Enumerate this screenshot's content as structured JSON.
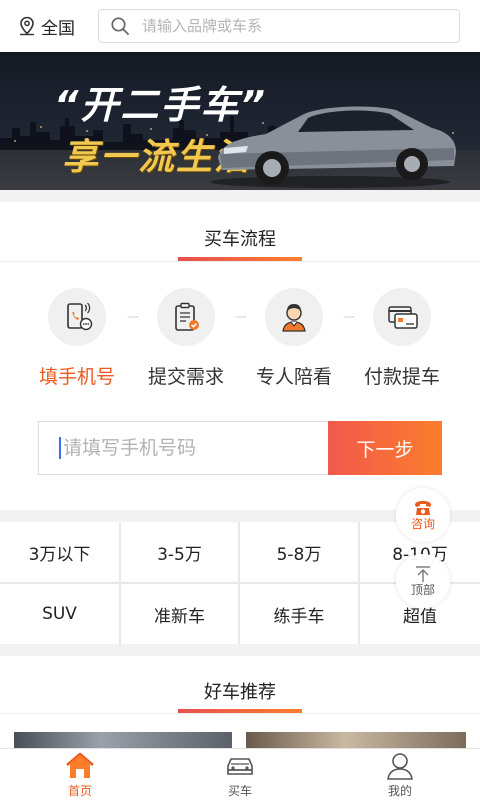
{
  "header": {
    "location_label": "全国",
    "search_placeholder": "请输入品牌或车系"
  },
  "banner": {
    "headline": "“开二手车”",
    "subline": "享一流生活"
  },
  "buy_process": {
    "title": "买车流程",
    "steps": [
      {
        "label": "填手机号",
        "icon": "phone-icon",
        "active": true
      },
      {
        "label": "提交需求",
        "icon": "clipboard-check-icon",
        "active": false
      },
      {
        "label": "专人陪看",
        "icon": "agent-icon",
        "active": false
      },
      {
        "label": "付款提车",
        "icon": "payment-card-icon",
        "active": false
      }
    ],
    "phone_placeholder": "请填写手机号码",
    "next_button": "下一步"
  },
  "filters": {
    "row1": [
      "3万以下",
      "3-5万",
      "5-8万",
      "8-10万"
    ],
    "row2": [
      "SUV",
      "准新车",
      "练手车",
      "超值"
    ]
  },
  "float_buttons": {
    "consult_label": "咨询",
    "top_label": "顶部"
  },
  "recommend": {
    "title": "好车推荐"
  },
  "tabbar": {
    "items": [
      {
        "label": "首页",
        "icon": "home-icon",
        "active": true
      },
      {
        "label": "买车",
        "icon": "car-icon",
        "active": false
      },
      {
        "label": "我的",
        "icon": "user-icon",
        "active": false
      }
    ]
  },
  "colors": {
    "accent": "#ea5a1e",
    "gradient_start": "#f2594b",
    "gradient_end": "#fb7d2c",
    "banner_text": "#f3c84e"
  }
}
